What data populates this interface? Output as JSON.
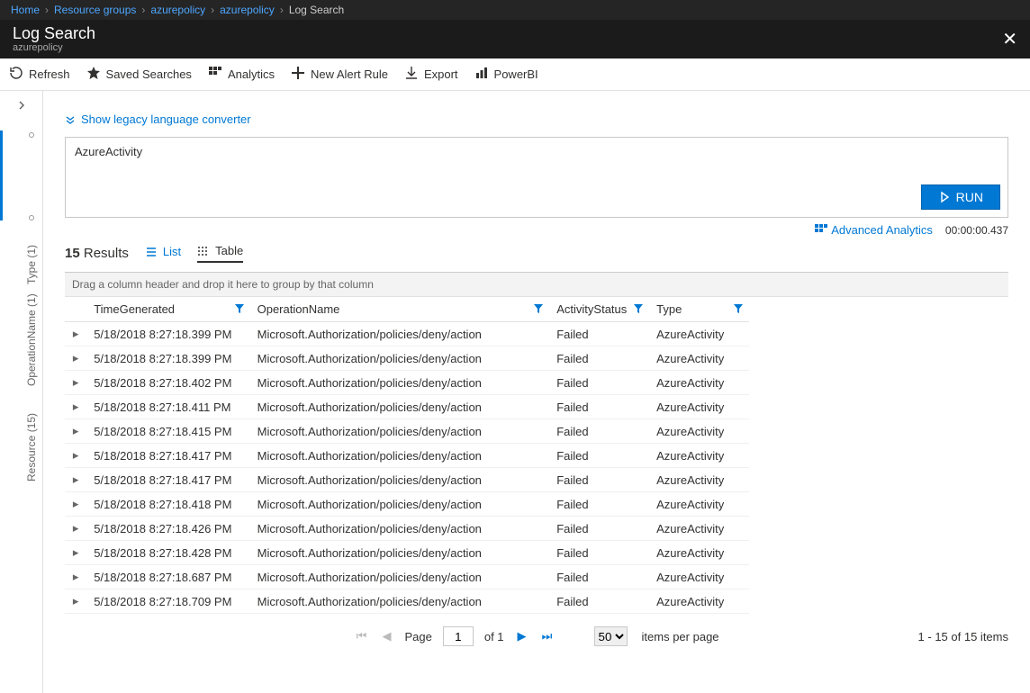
{
  "breadcrumb": [
    {
      "label": "Home",
      "link": true
    },
    {
      "label": "Resource groups",
      "link": true
    },
    {
      "label": "azurepolicy",
      "link": true
    },
    {
      "label": "azurepolicy",
      "link": true
    },
    {
      "label": "Log Search",
      "link": false
    }
  ],
  "header": {
    "title": "Log Search",
    "subtitle": "azurepolicy"
  },
  "toolbar": {
    "refresh": "Refresh",
    "saved_searches": "Saved Searches",
    "analytics": "Analytics",
    "new_alert": "New Alert Rule",
    "export": "Export",
    "powerbi": "PowerBI"
  },
  "legacy_link": "Show legacy language converter",
  "query_text": "AzureActivity",
  "run_label": "RUN",
  "advanced_analytics": "Advanced Analytics",
  "elapsed": "00:00:00.437",
  "results_count": "15",
  "results_label": "Results",
  "view_list": "List",
  "view_table": "Table",
  "group_hint": "Drag a column header and drop it here to group by that column",
  "columns": {
    "time": "TimeGenerated",
    "operation": "OperationName",
    "status": "ActivityStatus",
    "type": "Type"
  },
  "rows": [
    {
      "time": "5/18/2018 8:27:18.399 PM",
      "op": "Microsoft.Authorization/policies/deny/action",
      "status": "Failed",
      "type": "AzureActivity"
    },
    {
      "time": "5/18/2018 8:27:18.399 PM",
      "op": "Microsoft.Authorization/policies/deny/action",
      "status": "Failed",
      "type": "AzureActivity"
    },
    {
      "time": "5/18/2018 8:27:18.402 PM",
      "op": "Microsoft.Authorization/policies/deny/action",
      "status": "Failed",
      "type": "AzureActivity"
    },
    {
      "time": "5/18/2018 8:27:18.411 PM",
      "op": "Microsoft.Authorization/policies/deny/action",
      "status": "Failed",
      "type": "AzureActivity"
    },
    {
      "time": "5/18/2018 8:27:18.415 PM",
      "op": "Microsoft.Authorization/policies/deny/action",
      "status": "Failed",
      "type": "AzureActivity"
    },
    {
      "time": "5/18/2018 8:27:18.417 PM",
      "op": "Microsoft.Authorization/policies/deny/action",
      "status": "Failed",
      "type": "AzureActivity"
    },
    {
      "time": "5/18/2018 8:27:18.417 PM",
      "op": "Microsoft.Authorization/policies/deny/action",
      "status": "Failed",
      "type": "AzureActivity"
    },
    {
      "time": "5/18/2018 8:27:18.418 PM",
      "op": "Microsoft.Authorization/policies/deny/action",
      "status": "Failed",
      "type": "AzureActivity"
    },
    {
      "time": "5/18/2018 8:27:18.426 PM",
      "op": "Microsoft.Authorization/policies/deny/action",
      "status": "Failed",
      "type": "AzureActivity"
    },
    {
      "time": "5/18/2018 8:27:18.428 PM",
      "op": "Microsoft.Authorization/policies/deny/action",
      "status": "Failed",
      "type": "AzureActivity"
    },
    {
      "time": "5/18/2018 8:27:18.687 PM",
      "op": "Microsoft.Authorization/policies/deny/action",
      "status": "Failed",
      "type": "AzureActivity"
    },
    {
      "time": "5/18/2018 8:27:18.709 PM",
      "op": "Microsoft.Authorization/policies/deny/action",
      "status": "Failed",
      "type": "AzureActivity"
    }
  ],
  "side_labels": {
    "type": "Type (1)",
    "operation": "OperationName (1)",
    "resource": "Resource (15)"
  },
  "pager": {
    "page_label": "Page",
    "page_value": "1",
    "of_label": "of 1",
    "page_size": "50",
    "items_per_page": "items per page",
    "summary": "1 - 15 of 15 items"
  }
}
